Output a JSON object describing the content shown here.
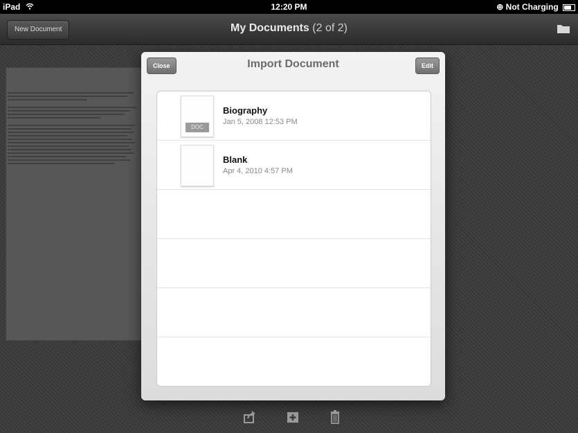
{
  "status": {
    "carrier": "iPad",
    "time": "12:20 PM",
    "charging": "Not Charging"
  },
  "toolbar": {
    "new_document": "New Document",
    "title_main": "My Documents",
    "title_count": "(2 of 2)"
  },
  "modal": {
    "title": "Import Document",
    "close": "Close",
    "edit": "Edit",
    "documents": [
      {
        "name": "Biography",
        "date": "Jan 5, 2008 12:53 PM",
        "badge": "DOC"
      },
      {
        "name": "Blank",
        "date": "Apr 4, 2010 4:57 PM"
      }
    ]
  },
  "icons": {
    "status": [
      "wifi-icon",
      "lock-rotation-icon",
      "battery-icon"
    ],
    "toolbar": [
      "folder-icon"
    ],
    "bottom": [
      "share-icon",
      "add-document-icon",
      "trash-icon"
    ]
  }
}
